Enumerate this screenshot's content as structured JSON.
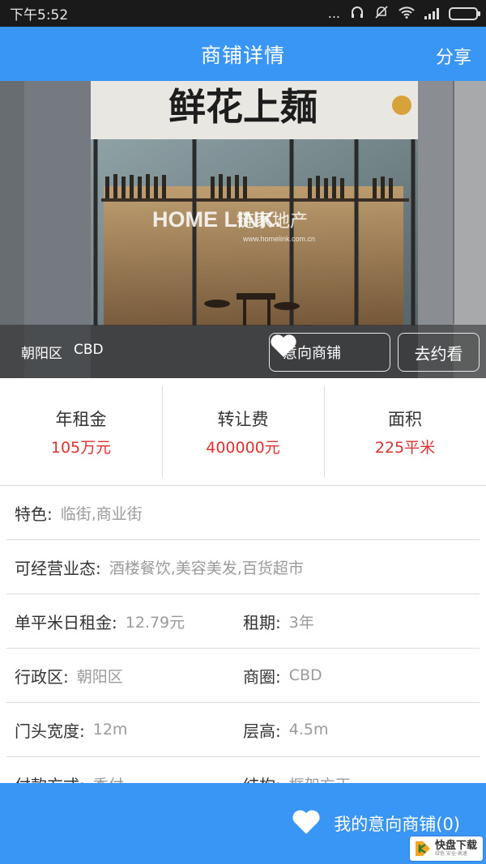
{
  "status_bar": {
    "time": "下午5:52",
    "dots": "...",
    "battery_color": "#7ed957"
  },
  "header": {
    "title": "商铺详情",
    "share_label": "分享",
    "bg_color": "#3a96f5"
  },
  "hero": {
    "district": "朝阳区",
    "area": "CBD",
    "favorite_label": "意向商铺",
    "visit_label": "去约看",
    "shop_sign": "鲜花上麺",
    "watermark_brand_en": "HOME LINK.",
    "watermark_brand_cn": "链家地产",
    "watermark_url": "www.homelink.com.cn"
  },
  "stats": [
    {
      "label": "年租金",
      "value": "105万元"
    },
    {
      "label": "转让费",
      "value": "400000元"
    },
    {
      "label": "面积",
      "value": "225平米"
    }
  ],
  "details": {
    "features": {
      "key": "特色:",
      "value": "临街,商业街"
    },
    "business_types": {
      "key": "可经营业态:",
      "value": "酒楼餐饮,美容美发,百货超市"
    },
    "daily_rent": {
      "key": "单平米日租金:",
      "value": "12.79元"
    },
    "lease_term": {
      "key": "租期:",
      "value": "3年"
    },
    "district": {
      "key": "行政区:",
      "value": "朝阳区"
    },
    "business_circle": {
      "key": "商圈:",
      "value": "CBD"
    },
    "frontage_width": {
      "key": "门头宽度:",
      "value": "12m"
    },
    "floor_height": {
      "key": "层高:",
      "value": "4.5m"
    },
    "payment": {
      "key": "付款方式:",
      "value": "季付"
    },
    "structure": {
      "key": "结构:",
      "value": "框架方正"
    }
  },
  "bottom_bar": {
    "label": "我的意向商铺(0)"
  },
  "site_watermark": {
    "text": "快盘下载",
    "sub": "绿色·安全·高速",
    "accent": "#f5a623"
  },
  "price_color": "#e03030"
}
